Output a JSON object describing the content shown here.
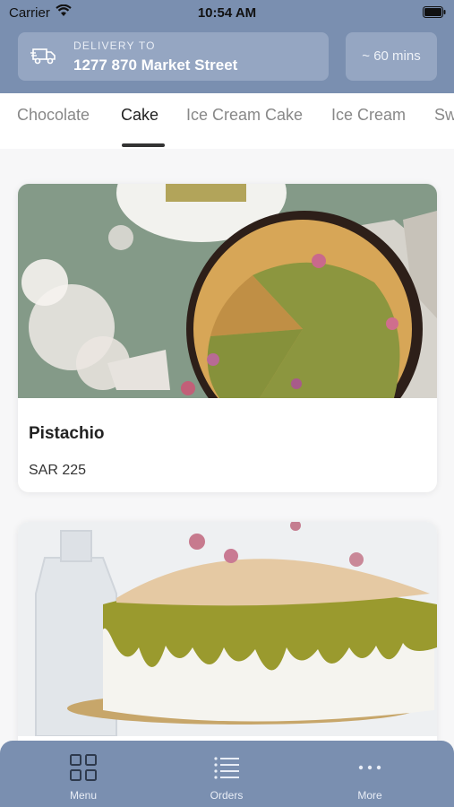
{
  "status_bar": {
    "carrier": "Carrier",
    "time": "10:54 AM"
  },
  "delivery": {
    "label": "DELIVERY TO",
    "address": "1277 870 Market Street",
    "eta": "~ 60 mins"
  },
  "categories": {
    "items": [
      "Chocolate",
      "Cake",
      "Ice Cream Cake",
      "Ice Cream",
      "Sw"
    ],
    "active": "Cake"
  },
  "products": [
    {
      "name": "Pistachio",
      "price": "SAR 225"
    },
    {
      "name": "",
      "price": ""
    }
  ],
  "tab_bar": {
    "menu": "Menu",
    "orders": "Orders",
    "more": "More"
  },
  "colors": {
    "header": "#7a8fb0",
    "card_accent": "#95a6c2",
    "pistachio_green": "#8a9a3d"
  },
  "icons": [
    "wifi-icon",
    "battery-icon",
    "truck-icon",
    "grid-icon",
    "list-icon",
    "more-icon"
  ]
}
